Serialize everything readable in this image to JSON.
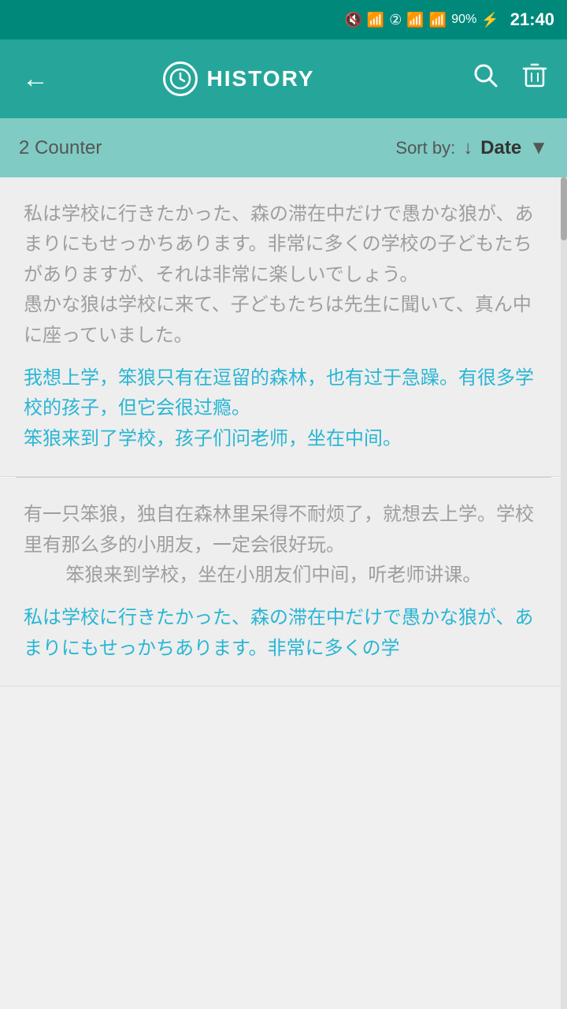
{
  "statusBar": {
    "time": "21:40",
    "battery": "90%"
  },
  "appBar": {
    "title": "HISTORY",
    "backLabel": "←",
    "searchLabel": "🔍",
    "deleteLabel": "🗑"
  },
  "sortBar": {
    "counter": "2 Counter",
    "sortByLabel": "Sort by:",
    "sortValue": "Date"
  },
  "items": [
    {
      "japanese": "私は学校に行きたかった、森の滞在中だけで愚かな狼が、あまりにもせっかちあります。非常に多くの学校の子どもたちがありますが、それは非常に楽しいでしょう。\n愚かな狼は学校に来て、子どもたちは先生に聞いて、真ん中に座っていました。",
      "chinese": "我想上学，笨狼只有在逗留的森林，也有过于急躁。有很多学校的孩子，但它会很过瘾。\n笨狼来到了学校，孩子们问老师，坐在中间。"
    },
    {
      "japanese": "有一只笨狼，独自在森林里呆得不耐烦了，就想去上学。学校里有那么多的小朋友，一定会很好玩。\n        笨狼来到学校，坐在小朋友们中间，听老师讲课。",
      "chinese": "私は学校に行きたかった、森の滞在中だけで愚かな狼が、あまりにもせっかちあります。非常に多くの学"
    }
  ]
}
